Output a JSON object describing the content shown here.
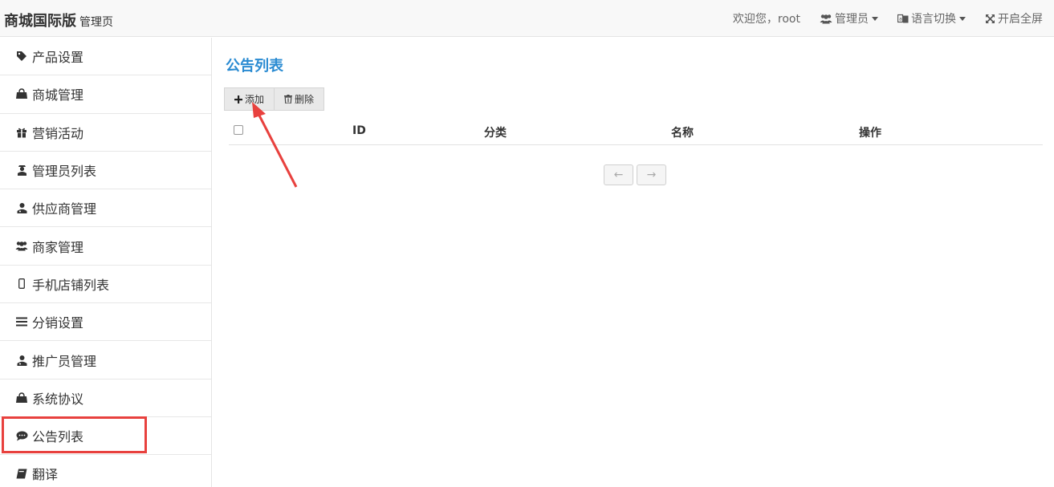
{
  "header": {
    "brand": "商城国际版",
    "brand_sub": "管理页",
    "welcome": "欢迎您，root",
    "admin_menu": "管理员",
    "language_menu": "语言切换",
    "fullscreen": "开启全屏"
  },
  "sidebar": {
    "items": [
      {
        "label": "产品设置",
        "icon": "tag-icon"
      },
      {
        "label": "商城管理",
        "icon": "shopping-bag-icon"
      },
      {
        "label": "营销活动",
        "icon": "gift-icon"
      },
      {
        "label": "管理员列表",
        "icon": "user-secret-icon"
      },
      {
        "label": "供应商管理",
        "icon": "user-md-icon"
      },
      {
        "label": "商家管理",
        "icon": "users-icon"
      },
      {
        "label": "手机店铺列表",
        "icon": "mobile-icon"
      },
      {
        "label": "分销设置",
        "icon": "bars-icon"
      },
      {
        "label": "推广员管理",
        "icon": "user-md-icon"
      },
      {
        "label": "系统协议",
        "icon": "shopping-bag-icon"
      },
      {
        "label": "公告列表",
        "icon": "comment-icon"
      },
      {
        "label": "翻译",
        "icon": "book-icon"
      }
    ],
    "highlighted": "公告列表"
  },
  "main": {
    "title": "公告列表",
    "toolbar": {
      "add_label": "添加",
      "delete_label": "删除"
    },
    "table": {
      "columns": [
        "ID",
        "分类",
        "名称",
        "操作"
      ]
    },
    "pager": {
      "prev": "←",
      "next": "→"
    }
  },
  "colors": {
    "accent": "#2a8bd2",
    "highlight": "#e8413e"
  }
}
